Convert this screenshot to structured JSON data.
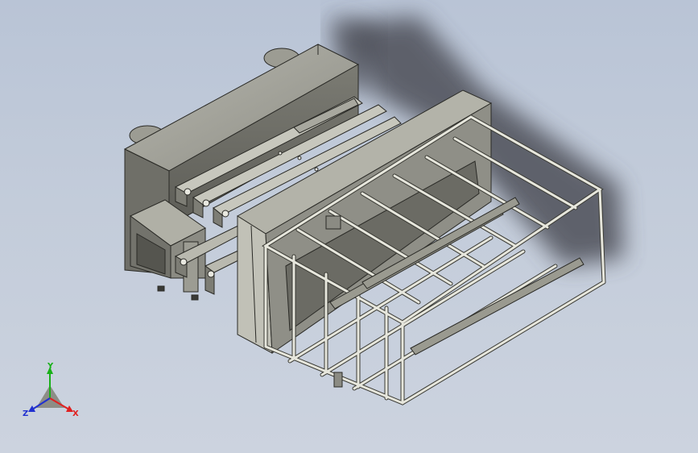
{
  "colors": {
    "background_top": "#b9c4d6",
    "background_bottom": "#ccd3df",
    "part_shade_dark": "#5b5b55",
    "part_shade_mid": "#85857c",
    "part_shade_light": "#a9a99f",
    "edge_line": "#2a2a26",
    "shadow": "#4d5058",
    "axis_x": "#e02020",
    "axis_y": "#18b018",
    "axis_z": "#2030d0"
  },
  "model": {
    "description_icon": "cad-assembly-icon",
    "parts": [
      "housing-block",
      "lifting-arms",
      "bracket-tray",
      "front-frame",
      "wire-basket"
    ]
  },
  "triad": {
    "x_label": "X",
    "y_label": "Y",
    "z_label": "Z"
  }
}
